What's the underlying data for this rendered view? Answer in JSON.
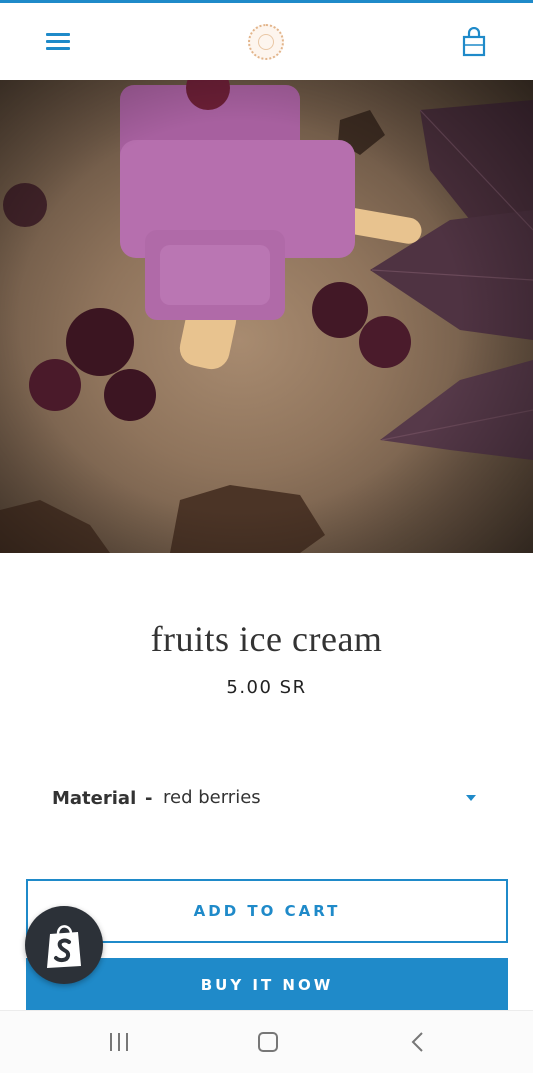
{
  "header": {
    "menu_icon": "hamburger-menu-icon",
    "logo_icon": "store-logo",
    "cart_icon": "shopping-bag-icon",
    "accent_color": "#1f8ac9"
  },
  "product": {
    "image_subject": "popsicles-berries-photo",
    "title": "fruits ice cream",
    "price": "5.00 SR",
    "variant": {
      "label": "Material",
      "separator": "-",
      "selected": "red berries"
    }
  },
  "actions": {
    "add_to_cart": "ADD TO CART",
    "buy_now": "BUY IT NOW"
  },
  "badge": {
    "icon": "shopify-bag-icon"
  },
  "navbar": {
    "recents_icon": "recent-apps-icon",
    "home_icon": "home-icon",
    "back_icon": "back-icon"
  }
}
